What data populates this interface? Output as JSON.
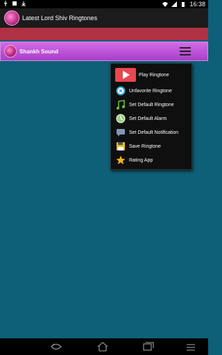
{
  "status": {
    "time": "16:38",
    "icons": [
      "usb-icon",
      "sd-card-icon",
      "download-icon",
      "wifi-icon",
      "signal-icon",
      "battery-icon"
    ]
  },
  "app": {
    "title": "Latest Lord Shiv Ringtones"
  },
  "now_playing": {
    "title": "Shankh Sound"
  },
  "menu": {
    "items": [
      {
        "label": "Play Ringtone",
        "icon": "play-icon",
        "color": "#e8484f"
      },
      {
        "label": "Unfavorite Ringtone",
        "icon": "unfavorite-icon",
        "color": "#29a8d6"
      },
      {
        "label": "Set Default Ringtone",
        "icon": "music-note-icon",
        "color": "#6cc43a"
      },
      {
        "label": "Set Default Alarm",
        "icon": "alarm-icon",
        "color": "#9bd07a"
      },
      {
        "label": "Set Default Notification",
        "icon": "notification-icon",
        "color": "#7f97b5"
      },
      {
        "label": "Save Ringtone",
        "icon": "save-icon",
        "color": "#e8c020"
      },
      {
        "label": "Rating App",
        "icon": "star-icon",
        "color": "#f0b51b"
      }
    ]
  },
  "colors": {
    "background": "#0d6078",
    "accent_band": "#b03044",
    "song_bar": "#c35be0"
  }
}
